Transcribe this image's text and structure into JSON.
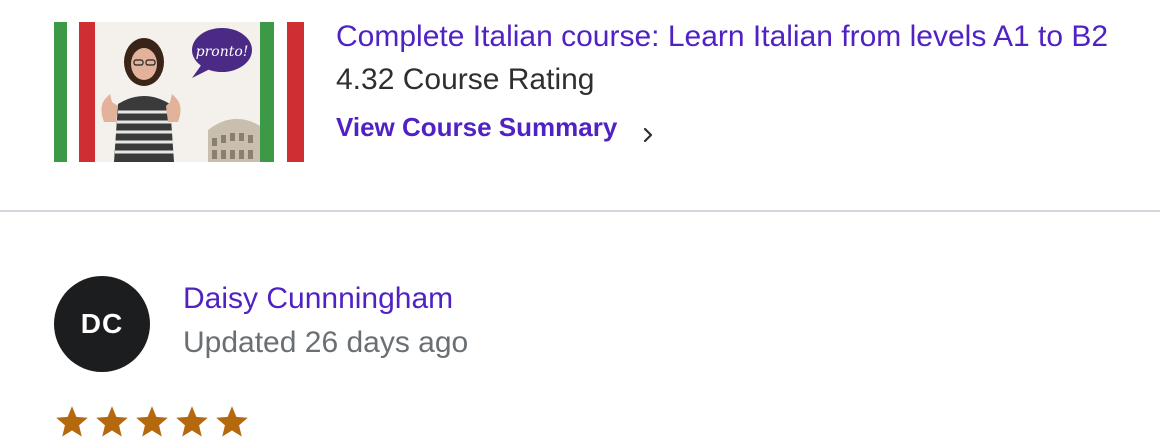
{
  "course": {
    "title": "Complete Italian course: Learn Italian from levels A1 to B2",
    "rating_text": "4.32 Course Rating",
    "summary_link": "View Course Summary",
    "thumbnail_badge": "pronto!"
  },
  "review": {
    "avatar_initials": "DC",
    "reviewer_name": "Daisy Cunnningham",
    "updated_text": "Updated 26 days ago",
    "stars": 5
  },
  "colors": {
    "link": "#5022c3",
    "star": "#b4690e",
    "avatar_bg": "#1c1d1f",
    "muted_text": "#6a6f73"
  }
}
